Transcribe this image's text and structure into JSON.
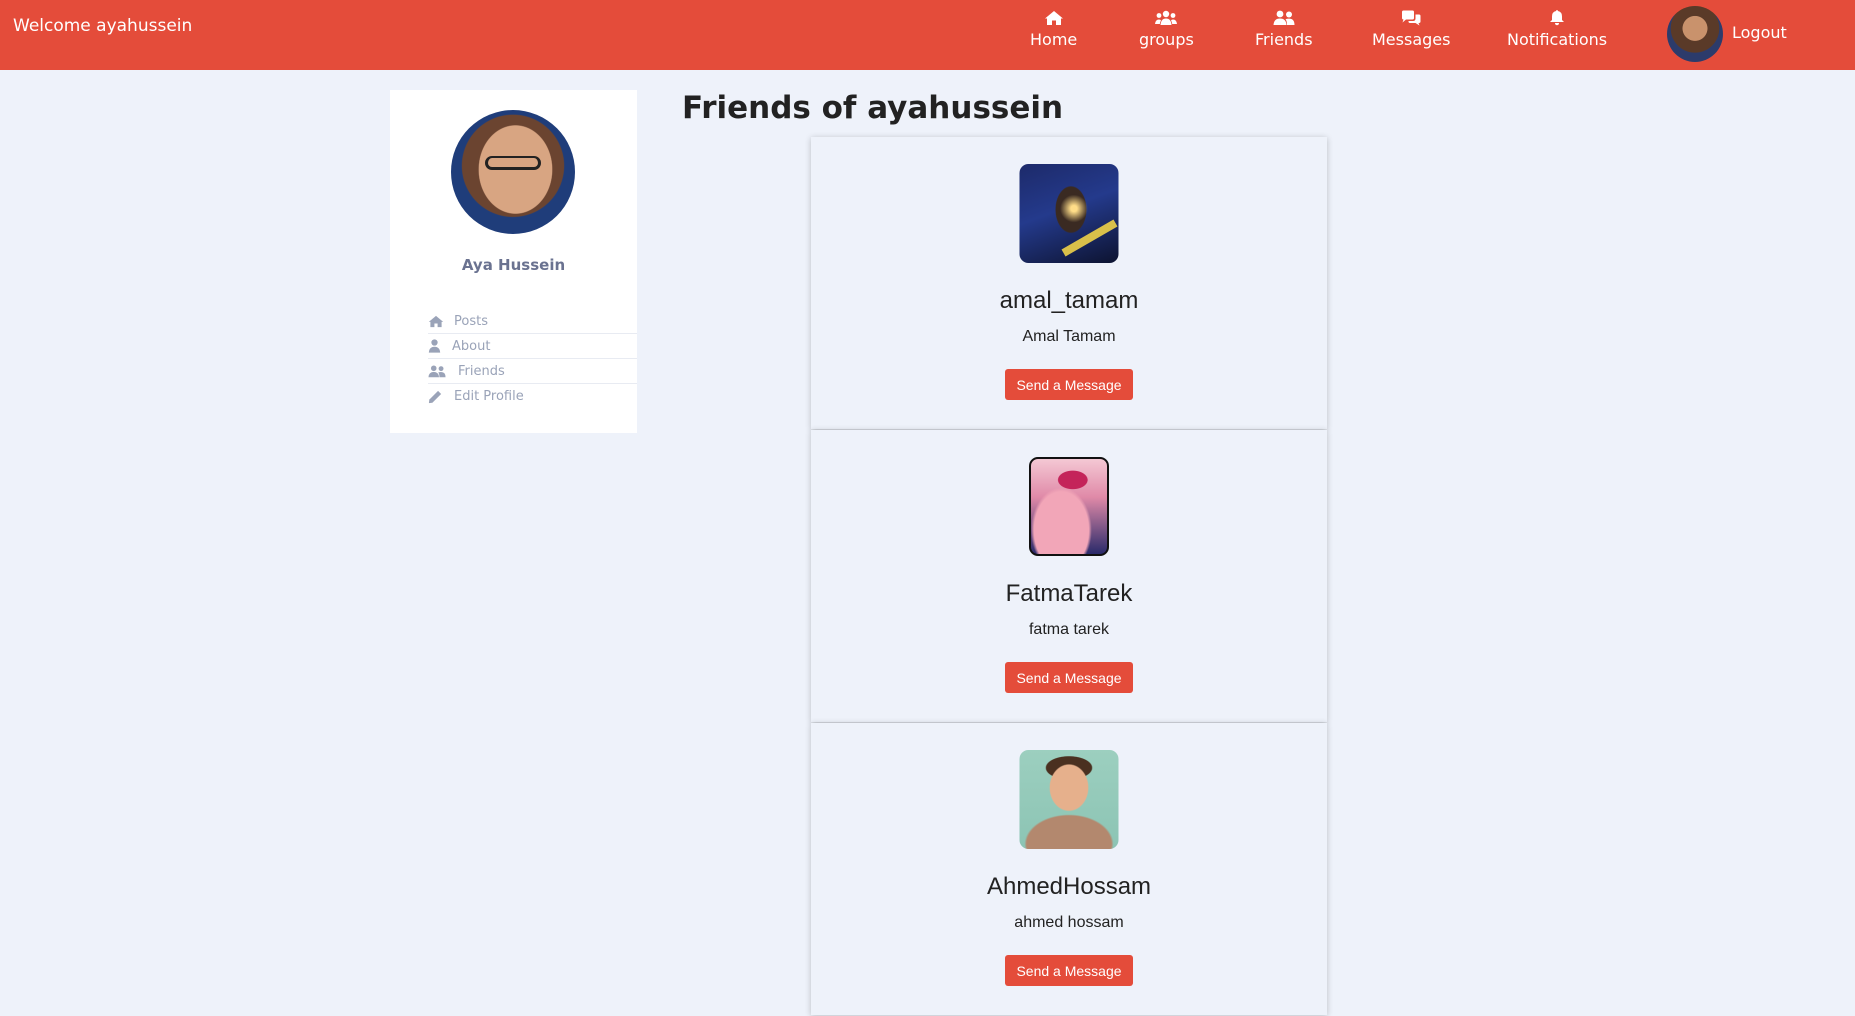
{
  "navbar": {
    "welcome": "Welcome ayahussein",
    "items": [
      {
        "label": "Home",
        "icon": "home-icon"
      },
      {
        "label": "groups",
        "icon": "groups-icon"
      },
      {
        "label": "Friends",
        "icon": "friends-icon"
      },
      {
        "label": "Messages",
        "icon": "messages-icon"
      },
      {
        "label": "Notifications",
        "icon": "bell-icon"
      }
    ],
    "logout": "Logout",
    "color": "#e44c3a"
  },
  "sidebar": {
    "name": "Aya Hussein",
    "menu": [
      {
        "label": "Posts",
        "icon": "home-icon"
      },
      {
        "label": "About",
        "icon": "user-icon"
      },
      {
        "label": "Friends",
        "icon": "friends-icon"
      },
      {
        "label": "Edit Profile",
        "icon": "pencil-icon"
      }
    ]
  },
  "main": {
    "title": "Friends of ayahussein",
    "friends": [
      {
        "username": "amal_tamam",
        "fullname": "Amal Tamam",
        "button": "Send a Message"
      },
      {
        "username": "FatmaTarek",
        "fullname": "fatma tarek",
        "button": "Send a Message"
      },
      {
        "username": "AhmedHossam",
        "fullname": "ahmed hossam",
        "button": "Send a Message"
      }
    ]
  }
}
